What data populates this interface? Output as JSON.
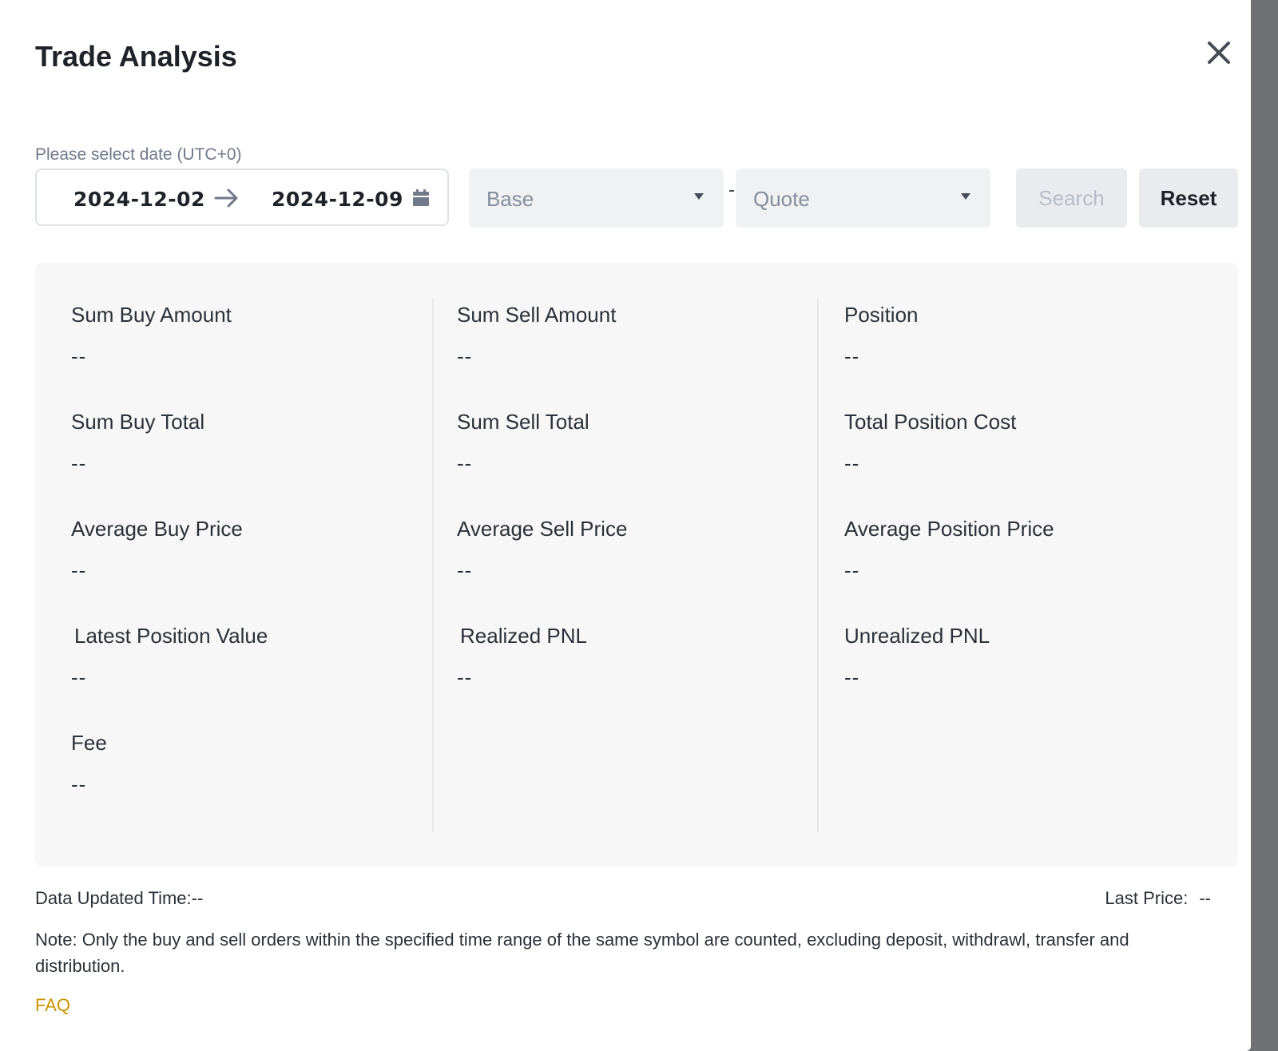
{
  "modal": {
    "title": "Trade Analysis"
  },
  "filters": {
    "date_label": "Please select date (UTC+0)",
    "date_start": "2024-12-02",
    "date_end": "2024-12-09",
    "base_placeholder": "Base",
    "quote_placeholder": "Quote",
    "search_label": "Search",
    "reset_label": "Reset"
  },
  "stats": [
    {
      "label": "Sum Buy Amount",
      "value": "--"
    },
    {
      "label": "Sum Sell Amount",
      "value": "--"
    },
    {
      "label": "Position",
      "value": "--"
    },
    {
      "label": "Sum Buy Total",
      "value": "--"
    },
    {
      "label": "Sum Sell Total",
      "value": "--"
    },
    {
      "label": "Total Position Cost",
      "value": "--"
    },
    {
      "label": "Average Buy Price",
      "value": "--"
    },
    {
      "label": "Average Sell Price",
      "value": "--"
    },
    {
      "label": "Average Position Price",
      "value": "--"
    },
    {
      "label": "Latest Position Value",
      "value": "--"
    },
    {
      "label": "Realized PNL",
      "value": "--"
    },
    {
      "label": "Unrealized PNL",
      "value": "--"
    },
    {
      "label": "Fee",
      "value": "--"
    }
  ],
  "footer": {
    "updated_time": "Data Updated Time:--",
    "last_price_label": "Last Price:",
    "last_price_value": "--",
    "note": "Note: Only the buy and sell orders within the specified time range of the same symbol are counted, excluding deposit, withdrawl, transfer and distribution.",
    "faq_label": "FAQ"
  },
  "colors": {
    "accent": "#c99400",
    "panel_bg": "#f7f7f8",
    "button_bg": "#e9ebee"
  },
  "icons": {
    "close": "close-icon",
    "arrow": "arrow-right-icon",
    "calendar": "calendar-icon",
    "caret": "caret-down-icon"
  }
}
